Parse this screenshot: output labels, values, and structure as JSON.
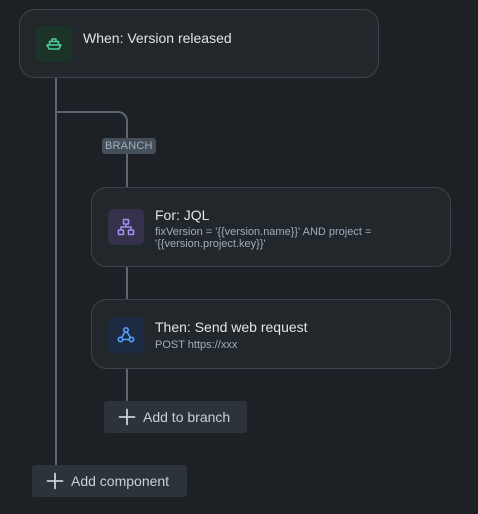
{
  "trigger": {
    "title": "When: Version released",
    "icon": "ship-icon",
    "color": "#4bce97"
  },
  "branch": {
    "label": "BRANCH"
  },
  "condition": {
    "title": "For: JQL",
    "description": "fixVersion = '{{version.name}}' AND project = '{{version.project.key}}'",
    "icon": "hierarchy-icon",
    "color": "#9f8fef"
  },
  "action": {
    "title": "Then: Send web request",
    "description": "POST https://xxx",
    "icon": "webhook-icon",
    "color": "#579dff"
  },
  "buttons": {
    "add_to_branch": "Add to branch",
    "add_component": "Add component"
  }
}
